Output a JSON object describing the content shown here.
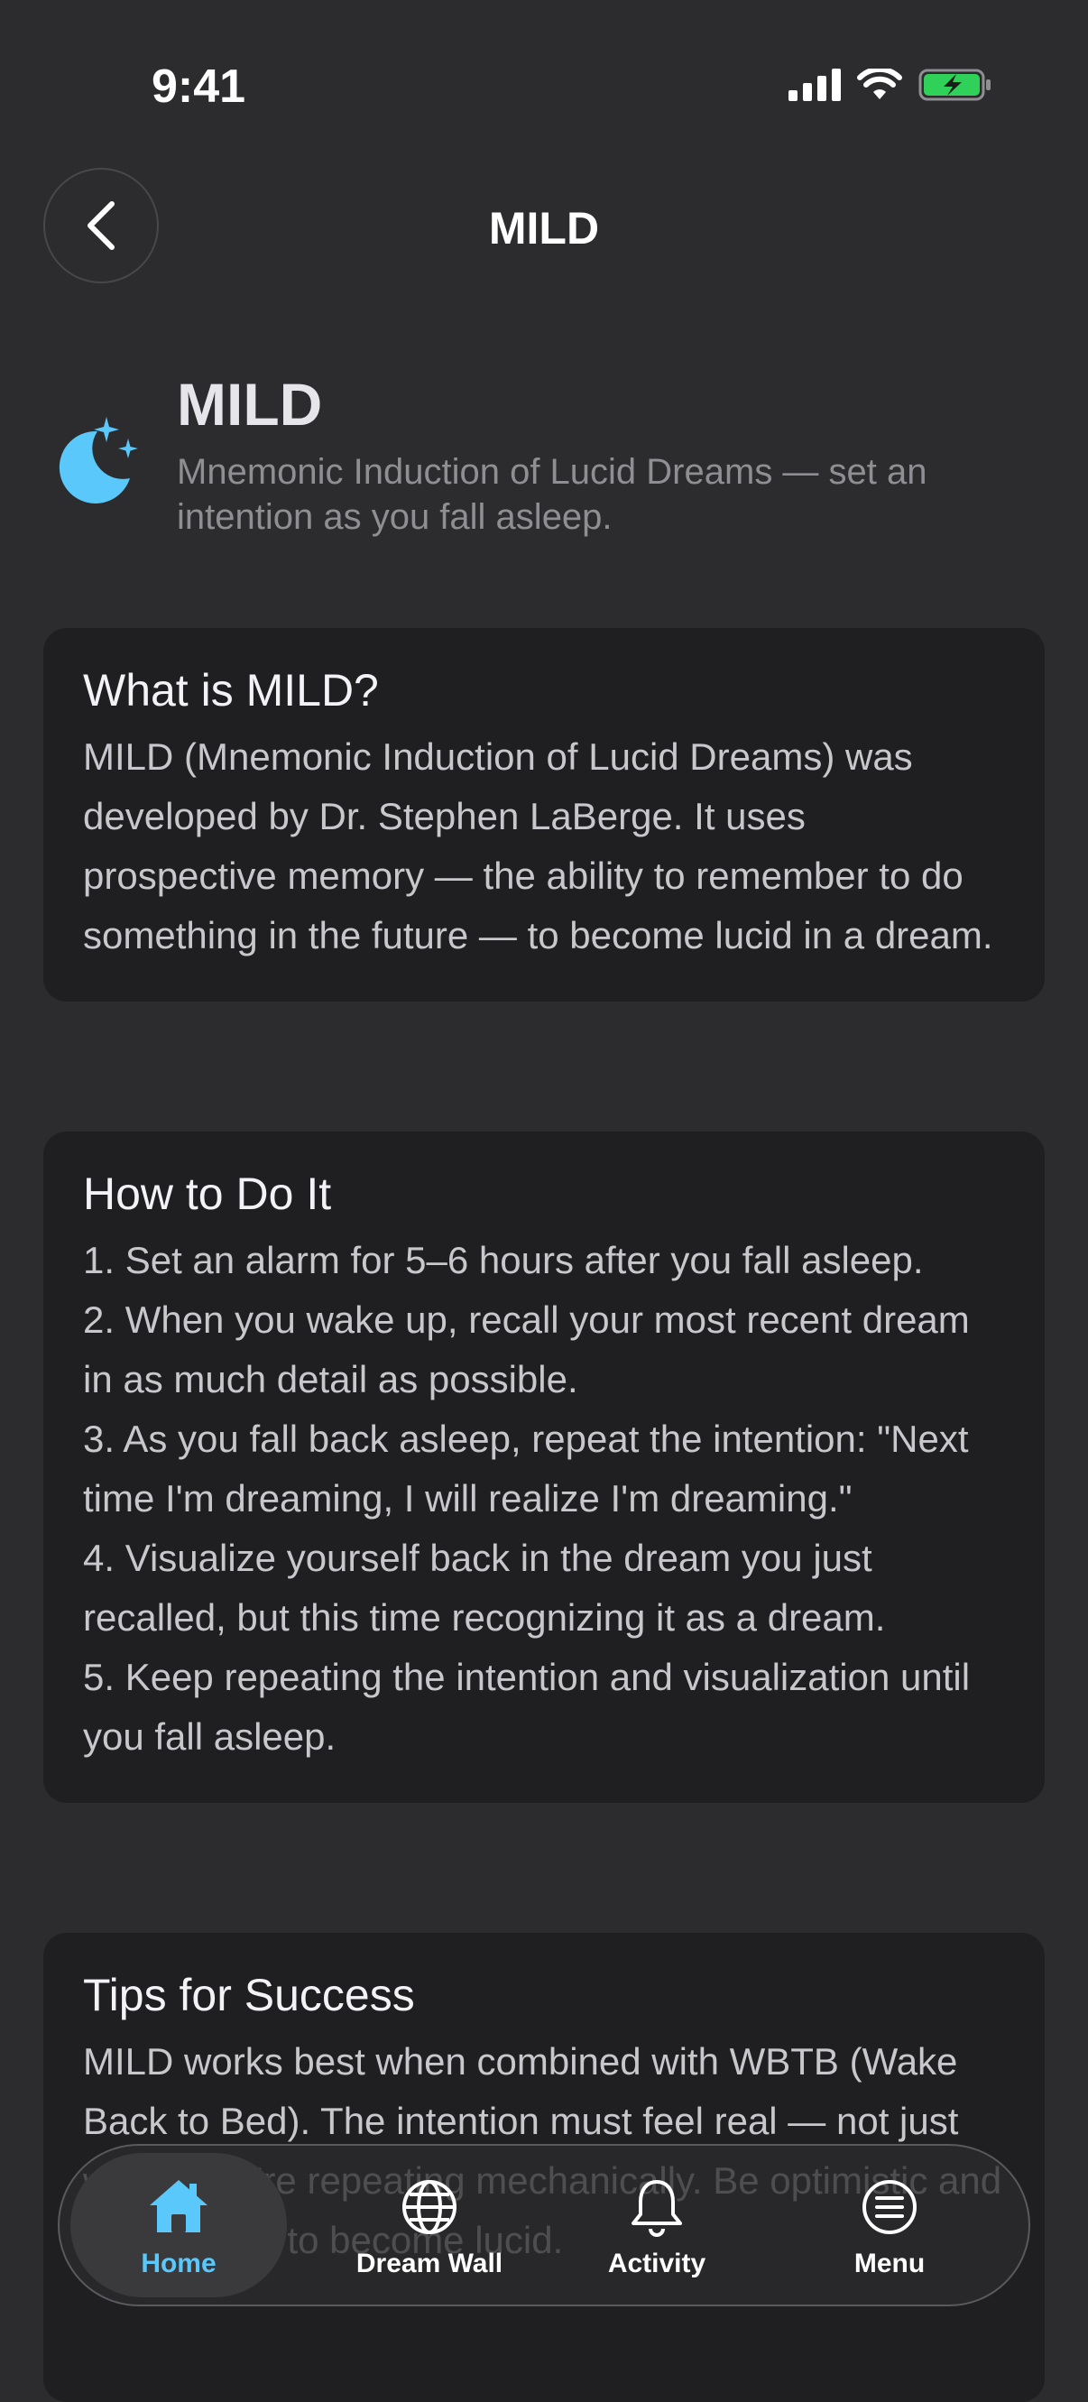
{
  "status": {
    "time": "9:41"
  },
  "nav": {
    "title": "MILD"
  },
  "header": {
    "title": "MILD",
    "subtitle": "Mnemonic Induction of Lucid Dreams — set an intention as you fall asleep."
  },
  "cards": [
    {
      "title": "What is MILD?",
      "body": "MILD (Mnemonic Induction of Lucid Dreams) was developed by Dr. Stephen LaBerge. It uses prospective memory — the ability to remember to do something in the future — to become lucid in a dream."
    },
    {
      "title": "How to Do It",
      "body": "1. Set an alarm for 5–6 hours after you fall asleep.\n2. When you wake up, recall your most recent dream in as much detail as possible.\n3. As you fall back asleep, repeat the intention: \"Next time I'm dreaming, I will realize I'm dreaming.\"\n4. Visualize yourself back in the dream you just recalled, but this time recognizing it as a dream.\n5. Keep repeating the intention and visualization until you fall asleep."
    },
    {
      "title": "Tips for Success",
      "body": "MILD works best when combined with WBTB (Wake Back to Bed). The intention must feel real — not just words you're repeating mechanically. Be optimistic and truly expect to become lucid."
    }
  ],
  "tabs": [
    {
      "label": "Home",
      "icon": "home-icon"
    },
    {
      "label": "Dream Wall",
      "icon": "globe-icon"
    },
    {
      "label": "Activity",
      "icon": "bell-icon"
    },
    {
      "label": "Menu",
      "icon": "menu-icon"
    }
  ],
  "colors": {
    "accent": "#5ac8fa",
    "card": "#1f1f21",
    "background": "#2c2c2e"
  }
}
